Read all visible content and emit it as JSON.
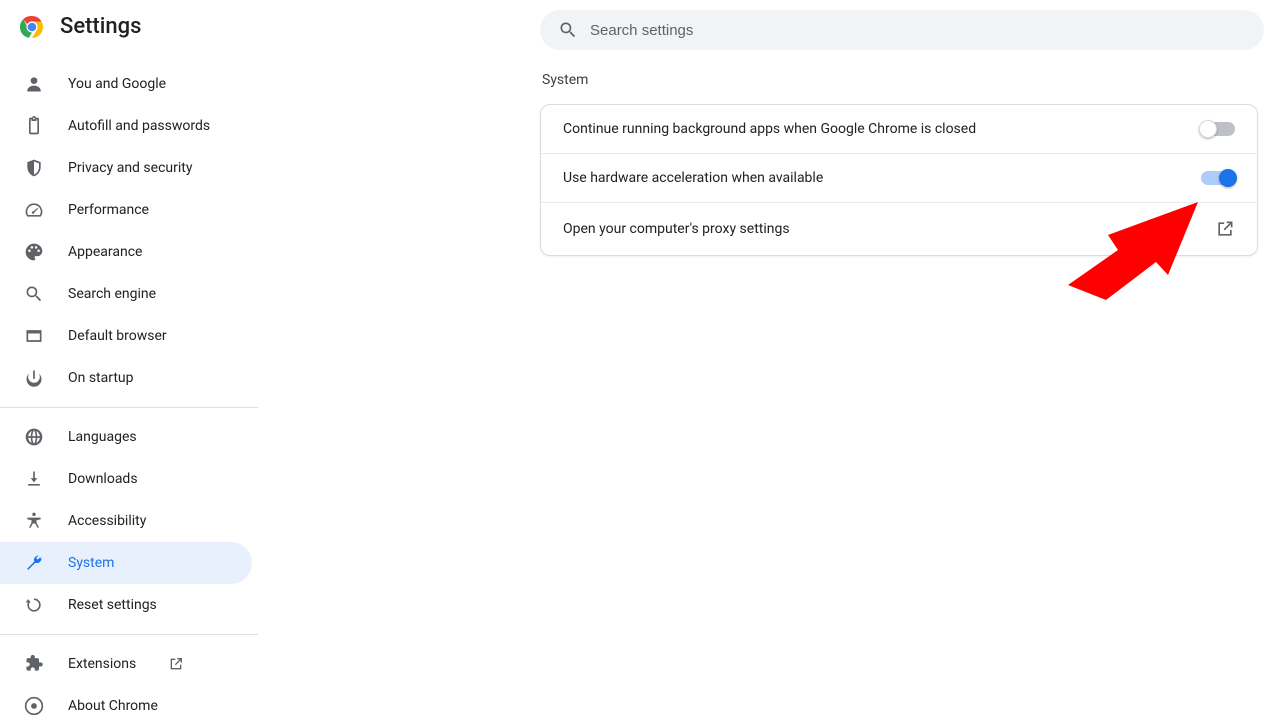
{
  "header": {
    "title": "Settings"
  },
  "search": {
    "placeholder": "Search settings"
  },
  "sidebar": {
    "group1": [
      {
        "label": "You and Google",
        "icon": "user"
      },
      {
        "label": "Autofill and passwords",
        "icon": "clipboard"
      },
      {
        "label": "Privacy and security",
        "icon": "shield"
      },
      {
        "label": "Performance",
        "icon": "speed"
      },
      {
        "label": "Appearance",
        "icon": "palette"
      },
      {
        "label": "Search engine",
        "icon": "search"
      },
      {
        "label": "Default browser",
        "icon": "window"
      },
      {
        "label": "On startup",
        "icon": "power"
      }
    ],
    "group2": [
      {
        "label": "Languages",
        "icon": "globe"
      },
      {
        "label": "Downloads",
        "icon": "download"
      },
      {
        "label": "Accessibility",
        "icon": "accessibility"
      },
      {
        "label": "System",
        "icon": "wrench",
        "active": true
      },
      {
        "label": "Reset settings",
        "icon": "restore"
      }
    ],
    "group3": [
      {
        "label": "Extensions",
        "icon": "extension",
        "external": true
      },
      {
        "label": "About Chrome",
        "icon": "chrome"
      }
    ]
  },
  "main": {
    "section_title": "System",
    "rows": [
      {
        "label": "Continue running background apps when Google Chrome is closed",
        "type": "toggle",
        "on": false
      },
      {
        "label": "Use hardware acceleration when available",
        "type": "toggle",
        "on": true
      },
      {
        "label": "Open your computer's proxy settings",
        "type": "link"
      }
    ]
  },
  "annotation": {
    "arrow_color": "#ff0000",
    "points_to": "hardware-acceleration-toggle"
  }
}
